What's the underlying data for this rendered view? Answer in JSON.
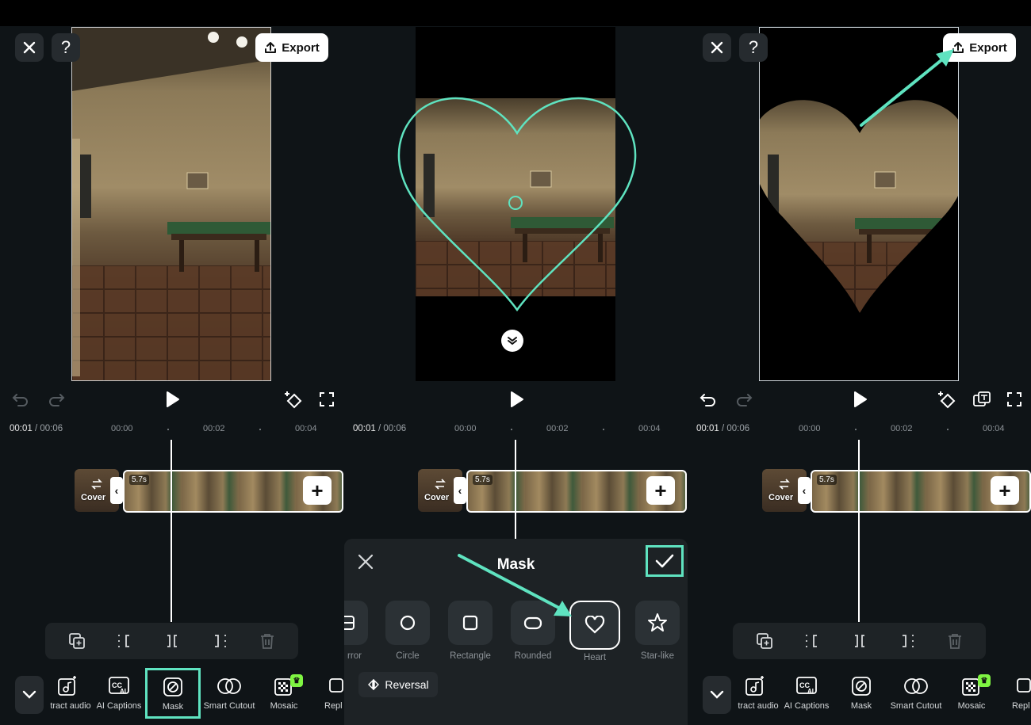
{
  "colors": {
    "accent": "#5fe3c0",
    "panel_bg": "#0f1417",
    "button_bg": "#262b2f"
  },
  "top": {
    "export_label": "Export",
    "help_label": "?"
  },
  "timeline": {
    "current": "00:01",
    "total": " / 00:06",
    "ticks": [
      "00:00",
      "00:02",
      "00:04"
    ],
    "clip_duration": "5.7s",
    "cover_label": "Cover"
  },
  "toolbar_panel1": [
    {
      "label": "tract audio",
      "icon": "extract-audio-icon"
    },
    {
      "label": "AI Captions",
      "icon": "ai-captions-icon"
    },
    {
      "label": "Mask",
      "icon": "mask-icon",
      "selected": true
    },
    {
      "label": "Smart Cutout",
      "icon": "smart-cutout-icon"
    },
    {
      "label": "Mosaic",
      "icon": "mosaic-icon"
    },
    {
      "label": "Repl",
      "icon": "replace-icon"
    }
  ],
  "toolbar_panel3": [
    {
      "label": "tract audio",
      "icon": "extract-audio-icon"
    },
    {
      "label": "AI Captions",
      "icon": "ai-captions-icon"
    },
    {
      "label": "Mask",
      "icon": "mask-icon"
    },
    {
      "label": "Smart Cutout",
      "icon": "smart-cutout-icon"
    },
    {
      "label": "Mosaic",
      "icon": "mosaic-icon"
    },
    {
      "label": "Repl",
      "icon": "replace-icon"
    }
  ],
  "mask_panel": {
    "title": "Mask",
    "shapes": [
      {
        "label": "rror",
        "icon": "mirror-icon"
      },
      {
        "label": "Circle",
        "icon": "circle-icon"
      },
      {
        "label": "Rectangle",
        "icon": "rectangle-icon"
      },
      {
        "label": "Rounded",
        "icon": "rounded-icon"
      },
      {
        "label": "Heart",
        "icon": "heart-icon",
        "selected": true
      },
      {
        "label": "Star-like",
        "icon": "star-icon"
      }
    ],
    "reversal_label": "Reversal"
  }
}
